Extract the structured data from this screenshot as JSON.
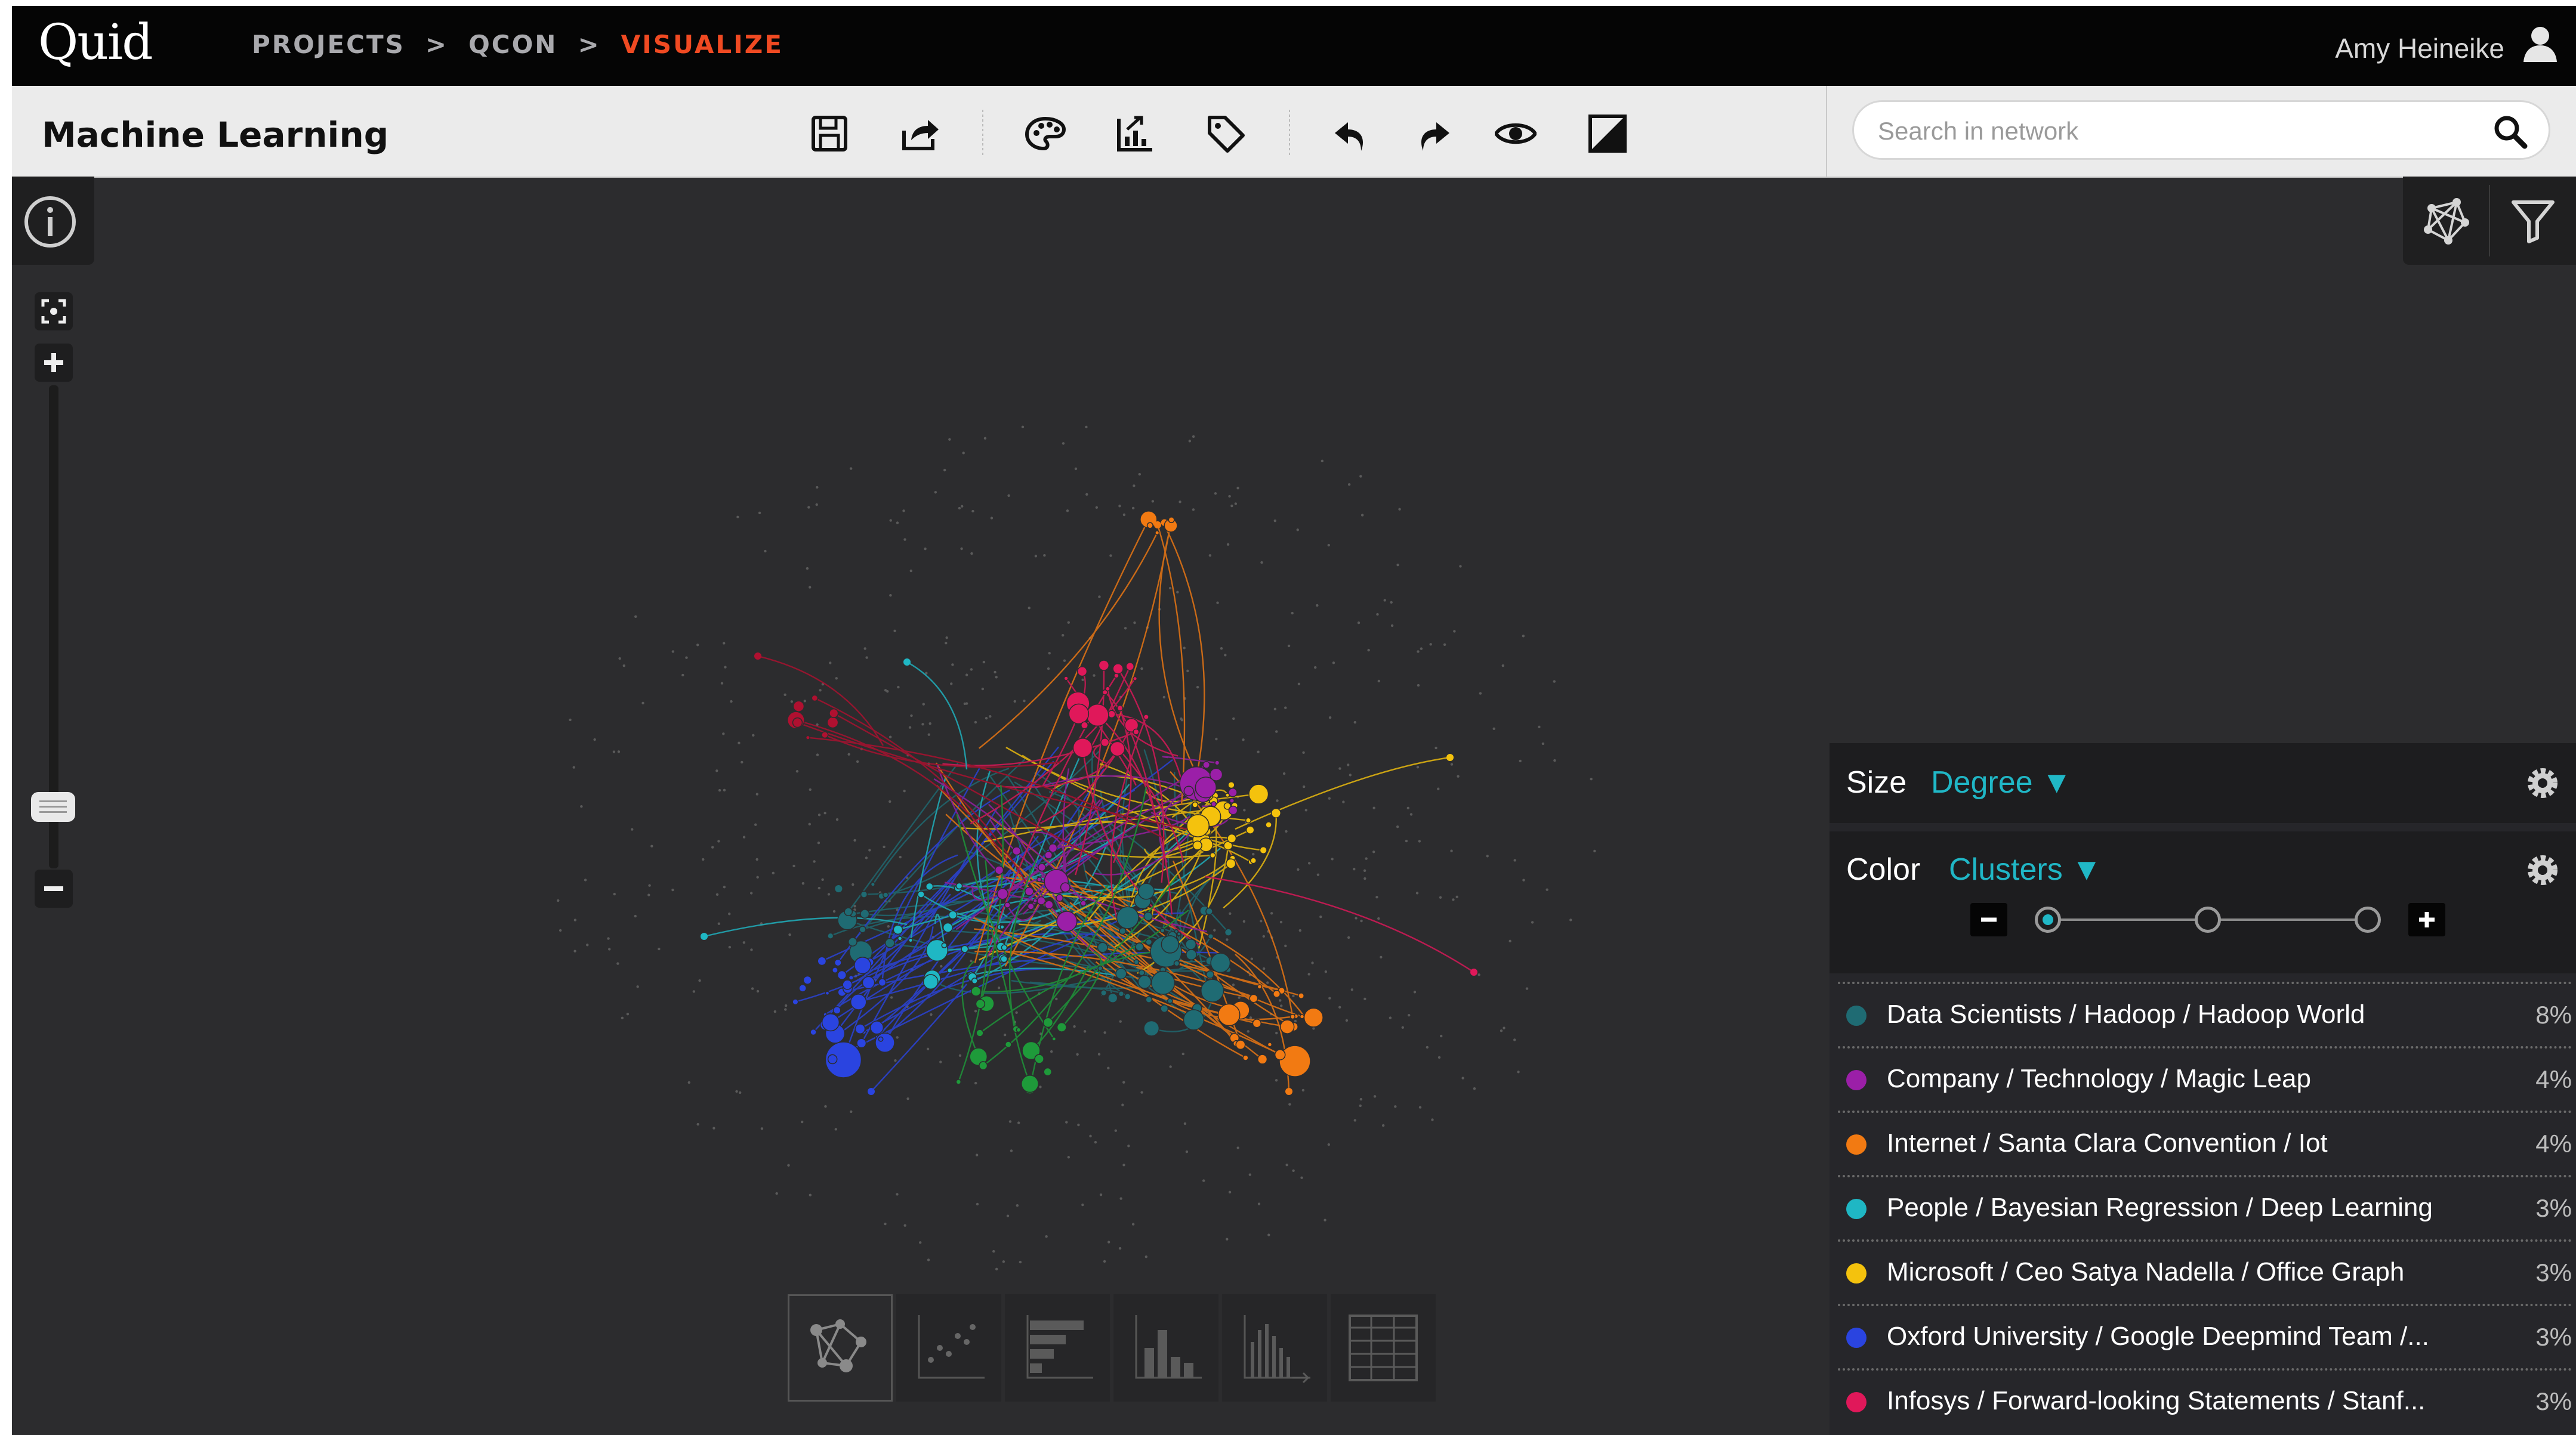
{
  "app": {
    "logo": "Quid"
  },
  "breadcrumbs": {
    "projects": "PROJECTS",
    "sep1": ">",
    "qcon": "QCON",
    "sep2": ">",
    "visualize": "VISUALIZE"
  },
  "user": {
    "name": "Amy Heineike"
  },
  "toolbar": {
    "title": "Machine Learning"
  },
  "search": {
    "placeholder": "Search in network",
    "value": ""
  },
  "panel": {
    "size_label": "Size",
    "size_value": "Degree ▼",
    "color_label": "Color",
    "color_value": "Clusters ▼",
    "clusters": [
      {
        "name": "Data Scientists / Hadoop / Hadoop World",
        "pct": "8%",
        "color": "#1f6b73"
      },
      {
        "name": "Company / Technology / Magic Leap",
        "pct": "4%",
        "color": "#9b1fa8"
      },
      {
        "name": "Internet / Santa Clara Convention / Iot",
        "pct": "4%",
        "color": "#f27a12"
      },
      {
        "name": "People / Bayesian Regression / Deep Learning",
        "pct": "3%",
        "color": "#1fb7c4"
      },
      {
        "name": "Microsoft / Ceo Satya Nadella / Office Graph",
        "pct": "3%",
        "color": "#f4c20d"
      },
      {
        "name": "Oxford University / Google Deepmind Team /...",
        "pct": "3%",
        "color": "#2a44e0"
      },
      {
        "name": "Infosys / Forward-looking Statements / Stanf...",
        "pct": "3%",
        "color": "#e0185a"
      }
    ]
  },
  "graph": {
    "colors": {
      "teal": "#1f6b73",
      "purple": "#9b1fa8",
      "orange": "#f27a12",
      "cyan": "#1fb7c4",
      "yellow": "#f4c20d",
      "blue": "#2a44e0",
      "pink": "#e0185a",
      "green": "#1e9a3a",
      "darkred": "#b01030"
    }
  }
}
